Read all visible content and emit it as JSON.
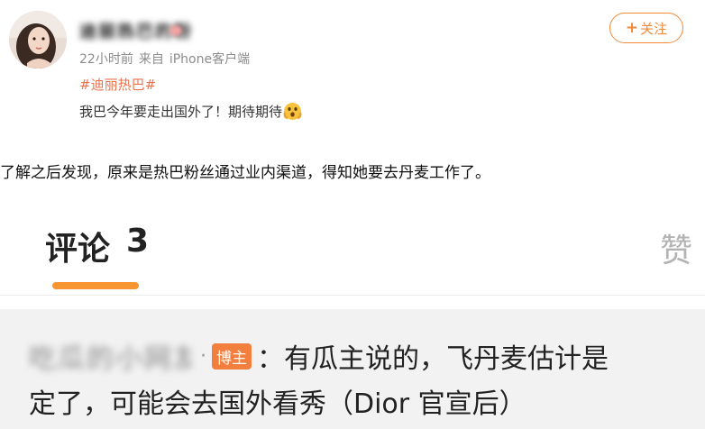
{
  "post": {
    "username": "迪丽热巴的粉",
    "time": "22小时前",
    "source_prefix": "来自",
    "source": "iPhone客户端",
    "hashtag": "#迪丽热巴#",
    "text": "我巴今年要走出国外了！期待期待",
    "follow_label": "关注",
    "follow_plus": "+"
  },
  "article": {
    "paragraph": "了解之后发现，原来是热巴粉丝通过业内渠道，得知她要去丹麦工作了。"
  },
  "comments": {
    "tab_label": "评论",
    "tab_count": "3",
    "likes_label": "赞",
    "first": {
      "user": "吃瓜的小网友",
      "separator": "·",
      "badge": "博主",
      "line1": "：有瓜主说的，飞丹麦估计是",
      "line2": "定了，可能会去国外看秀（Dior 官宣后）"
    }
  },
  "colors": {
    "accent": "#f28a3a",
    "hashtag": "#eb7350",
    "badge": "#f27f3d",
    "tab_underline": "#f79530"
  },
  "icons": {
    "avatar": "avatar-image",
    "emoji": "surprised-face-emoji"
  }
}
